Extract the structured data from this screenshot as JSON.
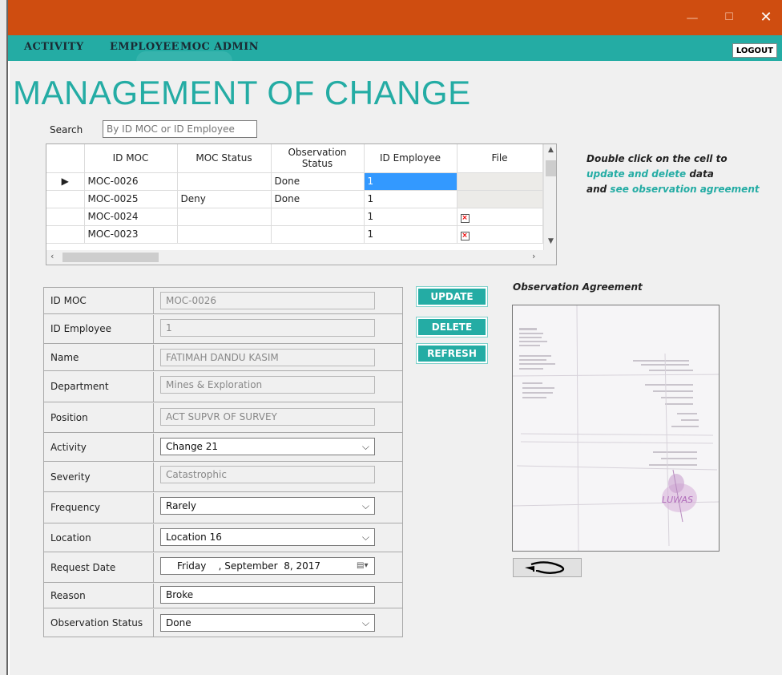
{
  "window": {
    "minimize_glyph": "—",
    "maximize_glyph": "☐",
    "close_glyph": "✕",
    "titlebar_color": "#cf4d10"
  },
  "menu": {
    "items": [
      "ACTIVITY",
      "EMPLOYEE",
      "MOC ADMIN"
    ],
    "logout_label": "LOGOUT",
    "accent_color": "#24aca4"
  },
  "page": {
    "title": "MANAGEMENT OF CHANGE"
  },
  "search": {
    "label": "Search",
    "placeholder": "By ID MOC or ID Employee"
  },
  "grid": {
    "columns": [
      "",
      "ID MOC",
      "MOC Status",
      "Observation Status",
      "ID Employee",
      "File"
    ],
    "rows": [
      {
        "marker": "▶",
        "id_moc": "MOC-0026",
        "moc_status": "",
        "obs_status": "Done",
        "id_employee": "1",
        "file": "image",
        "selected_cell": "id_employee"
      },
      {
        "marker": "",
        "id_moc": "MOC-0025",
        "moc_status": "Deny",
        "obs_status": "Done",
        "id_employee": "1",
        "file": "image"
      },
      {
        "marker": "",
        "id_moc": "MOC-0024",
        "moc_status": "",
        "obs_status": "",
        "id_employee": "1",
        "file": "error-icon"
      },
      {
        "marker": "",
        "id_moc": "MOC-0023",
        "moc_status": "",
        "obs_status": "",
        "id_employee": "1",
        "file": "error-icon"
      }
    ]
  },
  "hint": {
    "line1": "Double click on the cell to",
    "line2_teal": "update and delete",
    "line2_rest": " data",
    "line3_prefix": "and ",
    "line3_teal": "see observation agreement"
  },
  "form": {
    "id_moc": {
      "label": "ID MOC",
      "value": "MOC-0026"
    },
    "id_employee": {
      "label": "ID Employee",
      "value": "1"
    },
    "name": {
      "label": "Name",
      "value": "FATIMAH DANDU KASIM"
    },
    "department": {
      "label": "Department",
      "value": "Mines & Exploration"
    },
    "position": {
      "label": "Position",
      "value": "ACT SUPVR OF SURVEY"
    },
    "activity": {
      "label": "Activity",
      "value": "Change 21"
    },
    "severity": {
      "label": "Severity",
      "value": "Catastrophic"
    },
    "frequency": {
      "label": "Frequency",
      "value": "Rarely"
    },
    "location": {
      "label": "Location",
      "value": "Location 16"
    },
    "request_date": {
      "label": "Request Date",
      "value": "Friday    , September  8, 2017"
    },
    "reason": {
      "label": "Reason",
      "value": "Broke"
    },
    "observation_status": {
      "label": "Observation Status",
      "value": "Done"
    }
  },
  "buttons": {
    "update": "UPDATE",
    "delete": "DELETE",
    "refresh": "REFRESH"
  },
  "observation": {
    "label": "Observation Agreement",
    "stamp_text": "LUWAS"
  }
}
